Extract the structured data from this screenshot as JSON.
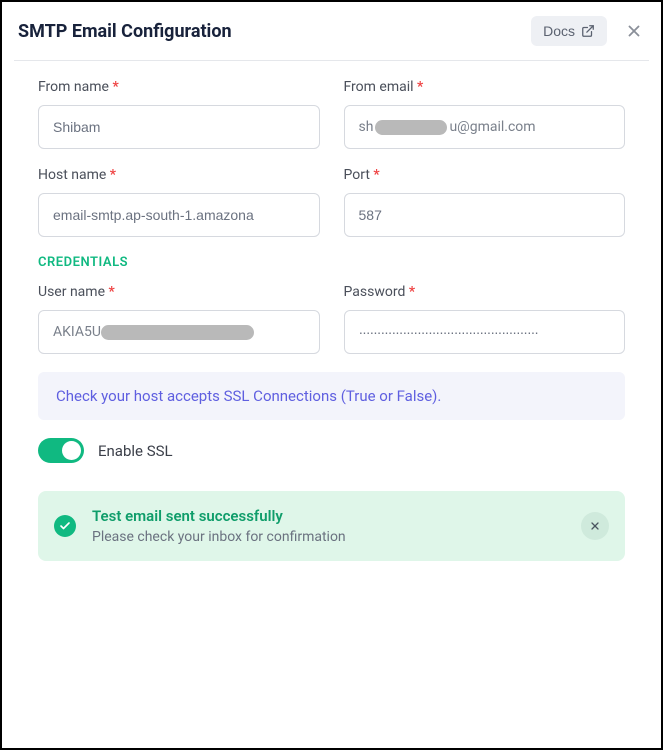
{
  "dialog": {
    "title": "SMTP Email Configuration",
    "docs_label": "Docs"
  },
  "fields": {
    "from_name": {
      "label": "From name",
      "value": "Shibam"
    },
    "from_email": {
      "label": "From email",
      "prefix": "sh",
      "suffix": "u@gmail.com"
    },
    "host_name": {
      "label": "Host name",
      "value": "email-smtp.ap-south-1.amazona"
    },
    "port": {
      "label": "Port",
      "value": "587"
    },
    "user_name": {
      "label": "User name",
      "prefix": "AKIA5U"
    },
    "password": {
      "label": "Password",
      "value": "·················································"
    }
  },
  "sections": {
    "credentials": "CREDENTIALS",
    "ssl_note": "Check your host accepts SSL Connections (True or False).",
    "ssl_toggle_label": "Enable SSL"
  },
  "toast": {
    "title": "Test email sent successfully",
    "subtitle": "Please check your inbox for confirmation"
  }
}
